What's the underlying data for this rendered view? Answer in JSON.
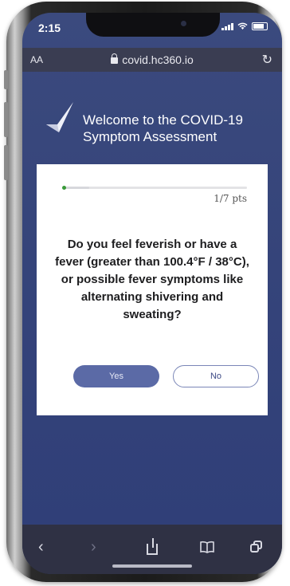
{
  "status_bar": {
    "time": "2:15"
  },
  "browser": {
    "text_size_label": "AA",
    "url": "covid.hc360.io"
  },
  "header": {
    "title": "Welcome to the COVID-19 Symptom Assessment"
  },
  "assessment": {
    "progress_fraction": 0.14,
    "progress_label": "1/7 pts",
    "question": "Do you feel feverish or have a fever (greater than 100.4°F / 38°C), or possible fever symptoms like alternating shivering and sweating?",
    "yes_label": "Yes",
    "no_label": "No"
  },
  "toolbar": {
    "back_icon": "chevron-left-icon",
    "forward_icon": "chevron-right-icon",
    "share_icon": "share-icon",
    "bookmarks_icon": "book-icon",
    "tabs_icon": "tabs-icon"
  },
  "colors": {
    "background": "#35447a",
    "accent": "#5b6aa6",
    "progress": "#3a9a3a"
  }
}
